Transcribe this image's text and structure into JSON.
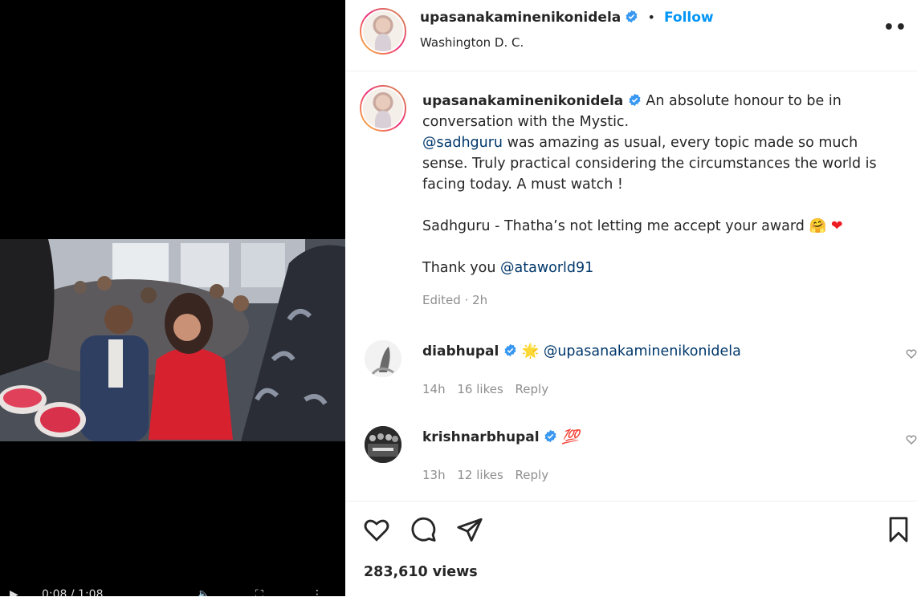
{
  "post": {
    "username": "upasanakaminenikonidela",
    "follow_label": "Follow",
    "separator": "•",
    "location": "Washington D. C.",
    "more_label": "••"
  },
  "caption": {
    "username": "upasanakaminenikonidela",
    "line1": "An absolute honour to be in conversation with the Mystic.",
    "mention": "@sadhguru",
    "line2": " was amazing as usual, every topic made so much sense. Truly practical considering the circumstances the world is facing today. A must watch !",
    "line3": "Sadhguru - Thatha’s not letting me accept your award",
    "line3_emoji_1": "🤗",
    "line3_emoji_2": "❤",
    "thanks_prefix": "Thank you ",
    "thanks_mention": "@ataworld91",
    "edited": "Edited · 2h"
  },
  "comments": [
    {
      "username": "diabhupal",
      "emoji": "🌟",
      "text": "@upasanakaminenikonidela",
      "time": "14h",
      "likes": "16 likes",
      "reply": "Reply"
    },
    {
      "username": "krishnarbhupal",
      "emoji": "💯",
      "text": "",
      "time": "13h",
      "likes": "12 likes",
      "reply": "Reply"
    }
  ],
  "stats": {
    "views": "283,610 views"
  },
  "video": {
    "time": "0:08 / 1:08"
  },
  "colors": {
    "accent": "#0095f6",
    "verified": "#3897f0",
    "text": "#262626",
    "muted": "#8e8e8e"
  },
  "icons": [
    "like-icon",
    "comment-icon",
    "share-icon",
    "save-icon",
    "verified-icon",
    "more-icon"
  ]
}
